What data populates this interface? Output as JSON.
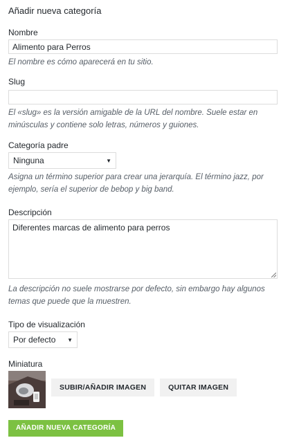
{
  "form": {
    "heading": "Añadir nueva categoría",
    "name": {
      "label": "Nombre",
      "value": "Alimento para Perros",
      "help": "El nombre es cómo aparecerá en tu sitio."
    },
    "slug": {
      "label": "Slug",
      "value": "",
      "help": "El «slug» es la versión amigable de la URL del nombre. Suele estar en minúsculas y contiene solo letras, números y guiones."
    },
    "parent": {
      "label": "Categoría padre",
      "selected": "Ninguna",
      "help": "Asigna un término superior para crear una jerarquía. El término jazz, por ejemplo, sería el superior de bebop y big band."
    },
    "description": {
      "label": "Descripción",
      "value": "Diferentes marcas de alimento para perros",
      "help": "La descripción no suele mostrarse por defecto, sin embargo hay algunos temas que puede que la muestren."
    },
    "display_type": {
      "label": "Tipo de visualización",
      "selected": "Por defecto"
    },
    "thumbnail": {
      "label": "Miniatura",
      "upload_label": "SUBIR/AÑADIR IMAGEN",
      "remove_label": "QUITAR IMAGEN"
    },
    "submit_label": "AÑADIR NUEVA CATEGORÍA"
  },
  "colors": {
    "accent_green": "#7cc142",
    "help_text": "#555d66",
    "border": "#dcdcdc"
  },
  "icons": {
    "select_arrow": "caret-down-icon",
    "resize": "resize-grip-icon"
  }
}
